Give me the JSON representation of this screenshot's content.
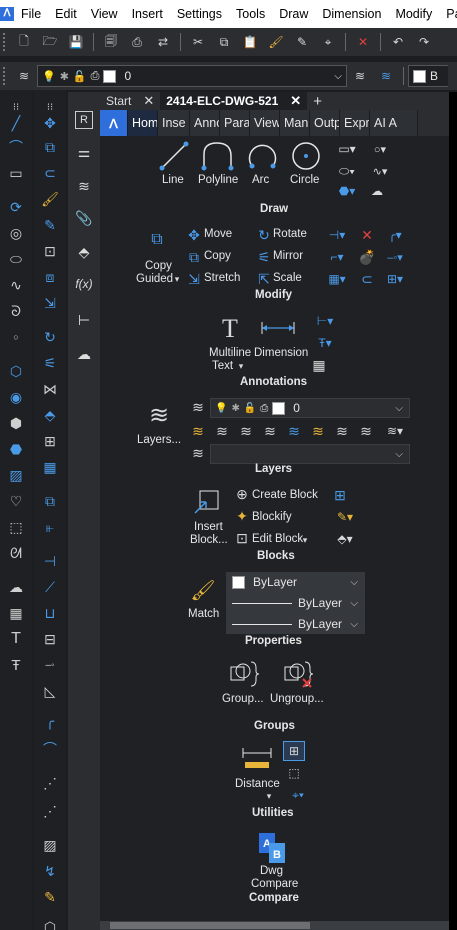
{
  "menubar": {
    "items": [
      "File",
      "Edit",
      "View",
      "Insert",
      "Settings",
      "Tools",
      "Draw",
      "Dimension",
      "Modify",
      "Par"
    ]
  },
  "layer_toolbar": {
    "layer_value": "0",
    "layer_color": "#ffffff",
    "bylayer_color": "#ffffff"
  },
  "doc_tabs": {
    "start": "Start",
    "active": "2414-ELC-DWG-521",
    "add": "+"
  },
  "ribbon_tabs": [
    "Hom",
    "Inse",
    "Anno",
    "Para",
    "View",
    "Man",
    "Outp",
    "Expr",
    "AI A"
  ],
  "draw": {
    "group": "Draw",
    "line": "Line",
    "polyline": "Polyline",
    "arc": "Arc",
    "circle": "Circle"
  },
  "modify": {
    "group": "Modify",
    "move": "Move",
    "rotate": "Rotate",
    "copy_guided": "Copy Guided",
    "copy_guided_1": "Copy",
    "copy_guided_2": "Guided",
    "copy": "Copy",
    "mirror": "Mirror",
    "stretch": "Stretch",
    "scale": "Scale"
  },
  "annotations": {
    "group": "Annotations",
    "multiline_1": "Multiline",
    "multiline_2": "Text",
    "dimension": "Dimension"
  },
  "layers": {
    "group": "Layers",
    "layers_btn": "Layers...",
    "layer_value": "0"
  },
  "blocks": {
    "group": "Blocks",
    "insert_1": "Insert",
    "insert_2": "Block...",
    "create": "Create Block",
    "blockify": "Blockify",
    "edit": "Edit Block"
  },
  "properties": {
    "group": "Properties",
    "match": "Match",
    "color": "ByLayer",
    "linetype": "ByLayer",
    "lineweight": "ByLayer"
  },
  "groups": {
    "group": "Groups",
    "group_btn": "Group...",
    "ungroup_btn": "Ungroup..."
  },
  "utilities": {
    "group": "Utilities",
    "distance": "Distance"
  },
  "compare": {
    "group": "Compare",
    "dwg_1": "Dwg",
    "dwg_2": "Compare"
  }
}
